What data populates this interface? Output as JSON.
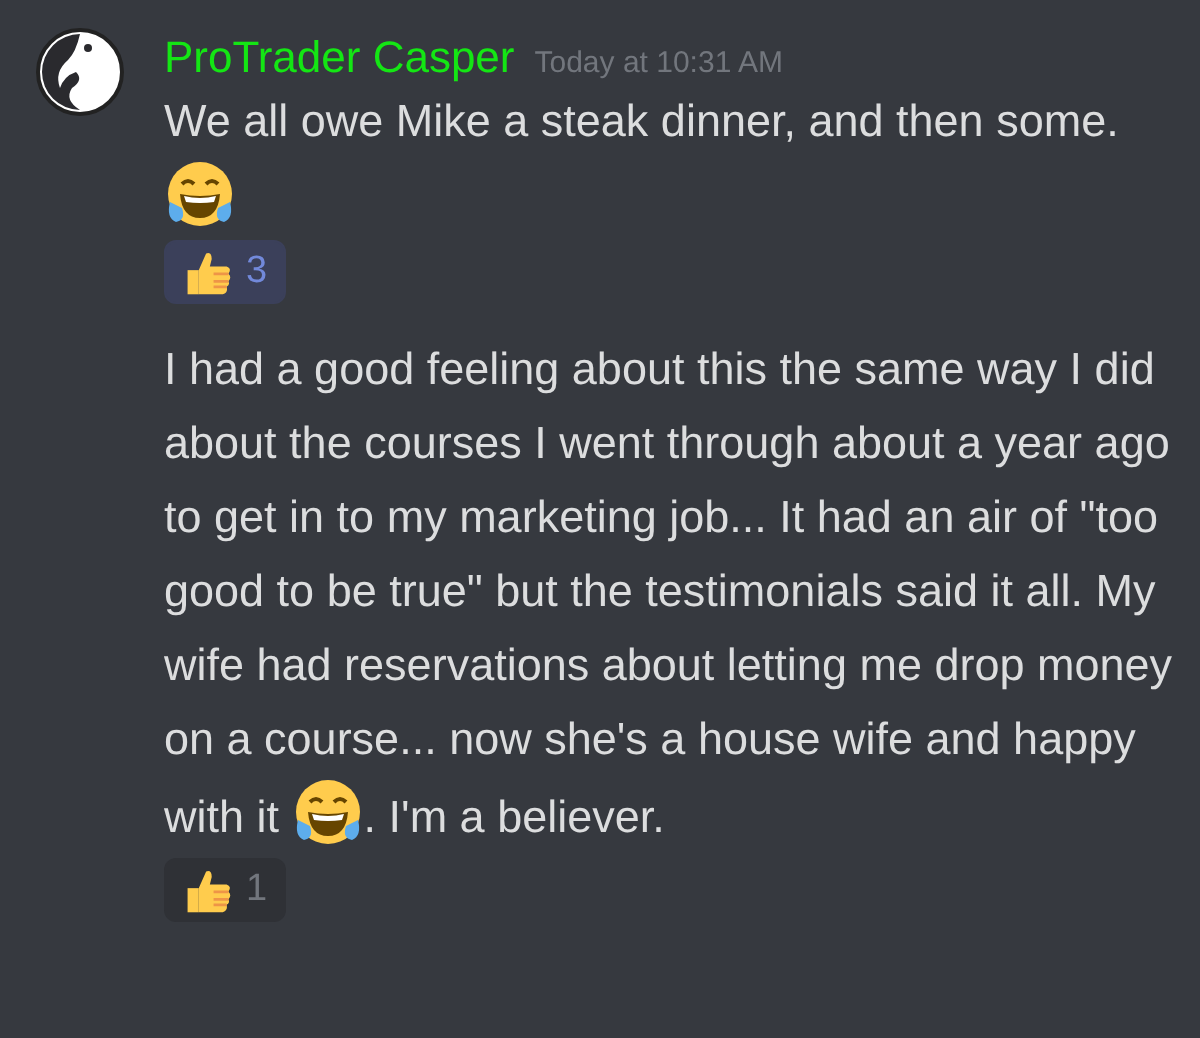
{
  "message": {
    "author": "ProTrader Casper",
    "timestamp": "Today at 10:31 AM",
    "entries": [
      {
        "parts": [
          {
            "kind": "text",
            "text": "We all owe Mike a steak dinner, and then some. "
          },
          {
            "kind": "emoji"
          }
        ],
        "reaction": {
          "count": "3",
          "selected": true
        }
      },
      {
        "parts": [
          {
            "kind": "text",
            "text": "I had a good feeling about this the same way I did about the courses I went through about a year ago to get in to my marketing job... It had an air of \"too good to be true\" but the testimonials said it all. My wife had reservations about letting me drop money on a course... now she's a house wife and happy with it "
          },
          {
            "kind": "emoji"
          },
          {
            "kind": "text",
            "text": ". I'm a believer."
          }
        ],
        "reaction": {
          "count": "1",
          "selected": false
        }
      }
    ]
  }
}
